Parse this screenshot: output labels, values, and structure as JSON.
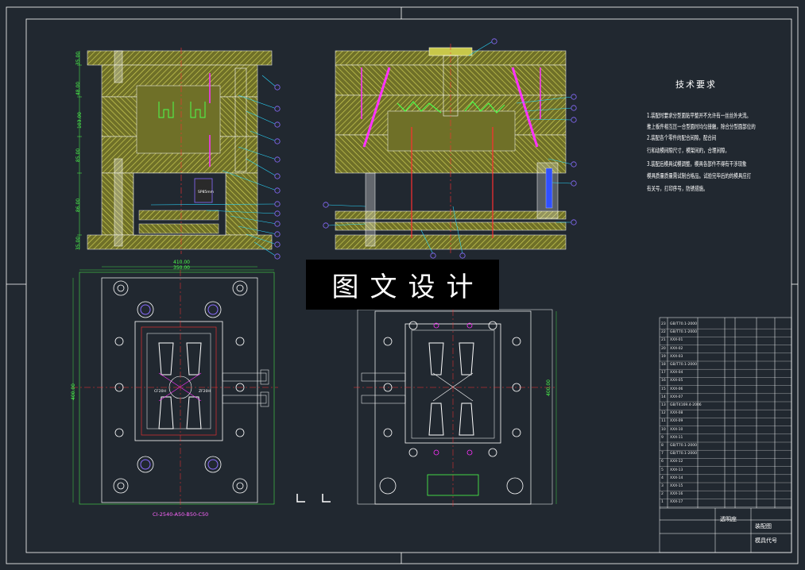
{
  "watermark": {
    "text": "图文设计"
  },
  "tech_requirements": {
    "title": "技术要求",
    "lines": [
      "1.装配时要求分型面贴平整并不允许有一丝丝外夹流。",
      "推上板件相互压一合型面时均匀接触，除合分型面部位的",
      "2.装配各个零件的配合间隙，配合间",
      "行和动模间隙尺寸，模架间的，合理间隙，",
      "3.装配后模具试模调整，模具各部件不得有干涉现象",
      "模具质量质量需试制合格品。试验完毕后的的模具应打",
      "有关号，打印序号，防锈措施。"
    ]
  },
  "title_block": {
    "part_name": "透明座",
    "drawing_label": "装配图",
    "drawing_no": "模具代号"
  },
  "dimensions": {
    "bottom_caption": "CI-2540-A50-B50-C50",
    "top_width_1": "410.00",
    "top_width_2": "350.00",
    "height_left": "400.00",
    "height_right": "400.00",
    "left_heights": [
      "35.00",
      "48.00",
      "103.00",
      "85.00",
      "86.00",
      "35.00"
    ],
    "cavity_label": "SP85mm",
    "center_tag_left": "CF20H",
    "center_tag_right": "ZF20H"
  },
  "bom": {
    "rows": [
      {
        "no": "23",
        "code": "GB/T70.1-2000"
      },
      {
        "no": "22",
        "code": "GB/T70.1-2000"
      },
      {
        "no": "21",
        "code": "XXX-01"
      },
      {
        "no": "20",
        "code": "XXX-02"
      },
      {
        "no": "19",
        "code": "XXX-03"
      },
      {
        "no": "18",
        "code": "GB/T70.1-2000"
      },
      {
        "no": "17",
        "code": "XXX-04"
      },
      {
        "no": "16",
        "code": "XXX-05"
      },
      {
        "no": "15",
        "code": "XXX-06"
      },
      {
        "no": "14",
        "code": "XXX-07"
      },
      {
        "no": "13",
        "code": "GB/T4169.4-2006"
      },
      {
        "no": "12",
        "code": "XXX-08"
      },
      {
        "no": "11",
        "code": "XXX-09"
      },
      {
        "no": "10",
        "code": "XXX-10"
      },
      {
        "no": "9",
        "code": "XXX-11"
      },
      {
        "no": "8",
        "code": "GB/T70.1-2000"
      },
      {
        "no": "7",
        "code": "GB/T70.1-2000"
      },
      {
        "no": "6",
        "code": "XXX-12"
      },
      {
        "no": "5",
        "code": "XXX-13"
      },
      {
        "no": "4",
        "code": "XXX-14"
      },
      {
        "no": "3",
        "code": "XXX-15"
      },
      {
        "no": "2",
        "code": "XXX-16"
      },
      {
        "no": "1",
        "code": "XXX-17"
      }
    ]
  },
  "colors": {
    "background": "#212830",
    "frame": "#ffffff",
    "hatch": "#c8c84a",
    "steel": "#7a7a2e",
    "leader": "#2ad8ff",
    "balloon": "#8a6cff",
    "centerline": "#ff3030",
    "dimension": "#4cff4c",
    "magenta": "#ff33ff"
  }
}
